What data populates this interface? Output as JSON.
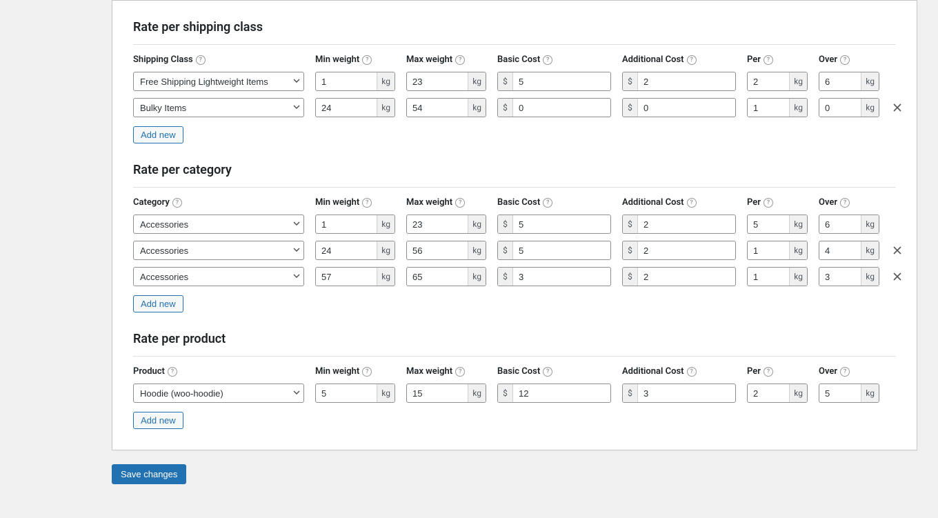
{
  "labels": {
    "min_weight": "Min weight",
    "max_weight": "Max weight",
    "basic_cost": "Basic Cost",
    "additional_cost": "Additional Cost",
    "per": "Per",
    "over": "Over",
    "add_new": "Add new",
    "save_changes": "Save changes"
  },
  "units": {
    "weight": "kg",
    "currency": "$"
  },
  "sections": {
    "shipping_class": {
      "title": "Rate per shipping class",
      "selector_label": "Shipping Class",
      "rows": [
        {
          "select": "Free Shipping Lightweight Items",
          "min_weight": "1",
          "max_weight": "23",
          "basic_cost": "5",
          "additional_cost": "2",
          "per": "2",
          "over": "6",
          "removable": false
        },
        {
          "select": "Bulky Items",
          "min_weight": "24",
          "max_weight": "54",
          "basic_cost": "0",
          "additional_cost": "0",
          "per": "1",
          "over": "0",
          "removable": true
        }
      ]
    },
    "category": {
      "title": "Rate per category",
      "selector_label": "Category",
      "rows": [
        {
          "select": "Accessories",
          "min_weight": "1",
          "max_weight": "23",
          "basic_cost": "5",
          "additional_cost": "2",
          "per": "5",
          "over": "6",
          "removable": false
        },
        {
          "select": "Accessories",
          "min_weight": "24",
          "max_weight": "56",
          "basic_cost": "5",
          "additional_cost": "2",
          "per": "1",
          "over": "4",
          "removable": true
        },
        {
          "select": "Accessories",
          "min_weight": "57",
          "max_weight": "65",
          "basic_cost": "3",
          "additional_cost": "2",
          "per": "1",
          "over": "3",
          "removable": true
        }
      ]
    },
    "product": {
      "title": "Rate per product",
      "selector_label": "Product",
      "rows": [
        {
          "select": "Hoodie (woo-hoodie)",
          "min_weight": "5",
          "max_weight": "15",
          "basic_cost": "12",
          "additional_cost": "3",
          "per": "2",
          "over": "5",
          "removable": false
        }
      ]
    }
  }
}
